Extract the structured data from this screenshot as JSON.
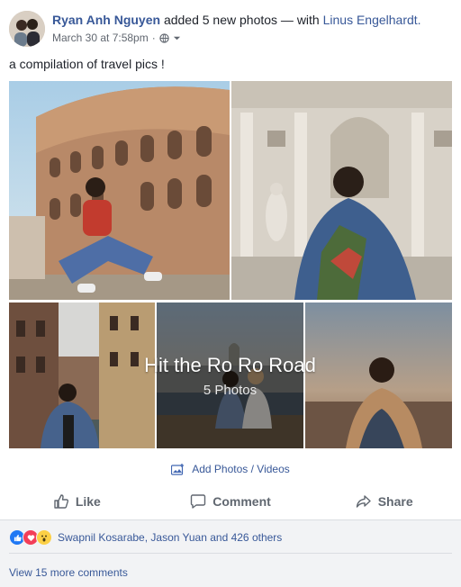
{
  "post": {
    "author": "Ryan Anh Nguyen",
    "action_text": "added 5 new photos — with",
    "tagged": "Linus Engelhardt.",
    "timestamp": "March 30 at 7:58pm",
    "separator": "·",
    "caption": "a compilation of travel pics !"
  },
  "album": {
    "title": "Hit the Ro Ro Road",
    "count": "5 Photos"
  },
  "add_photos_label": "Add Photos / Videos",
  "actions": {
    "like": "Like",
    "comment": "Comment",
    "share": "Share"
  },
  "reactions": {
    "summary": "Swapnil Kosarabe, Jason Yuan and 426 others",
    "colors": {
      "like": "#2078f4",
      "love": "#f33e58",
      "wow": "#fcd046"
    }
  },
  "comments": {
    "view_more": "View 15 more comments"
  },
  "colors": {
    "link": "#385898",
    "secondary_text": "#606770",
    "reaction_bar": "#f2f3f5"
  }
}
